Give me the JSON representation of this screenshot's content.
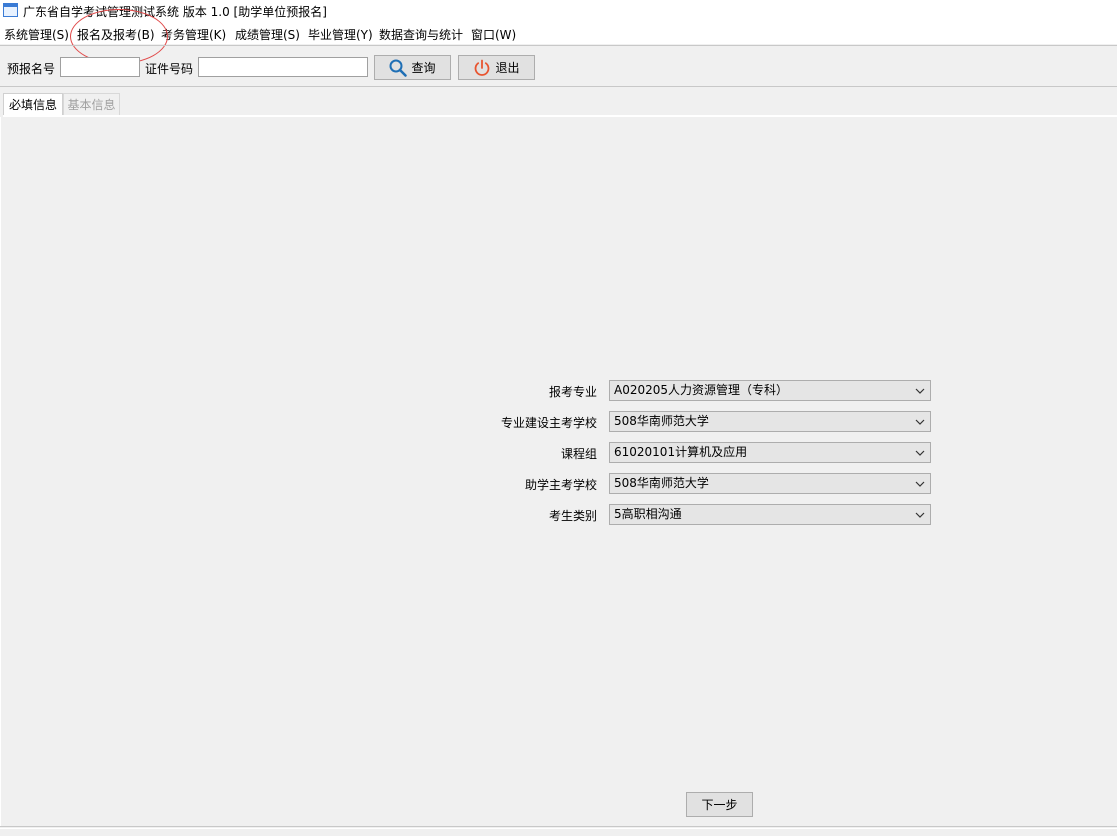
{
  "window": {
    "title": "广东省自学考试管理测试系统 版本 1.0 [助学单位预报名]"
  },
  "menu": {
    "items": [
      {
        "label": "系统管理(S)"
      },
      {
        "label": "报名及报考(B)"
      },
      {
        "label": "考务管理(K)"
      },
      {
        "label": "成绩管理(S)"
      },
      {
        "label": "毕业管理(Y)"
      },
      {
        "label": "数据查询与统计"
      },
      {
        "label": "窗口(W)"
      }
    ]
  },
  "toolbar": {
    "prereg_label": "预报名号",
    "prereg_value": "",
    "id_label": "证件号码",
    "id_value": "",
    "query_label": "查询",
    "exit_label": "退出"
  },
  "tabs": [
    {
      "label": "必填信息",
      "active": true
    },
    {
      "label": "基本信息",
      "active": false
    }
  ],
  "form": {
    "fields": [
      {
        "label": "报考专业",
        "value": "A020205人力资源管理（专科）"
      },
      {
        "label": "专业建设主考学校",
        "value": "508华南师范大学"
      },
      {
        "label": "课程组",
        "value": "61020101计算机及应用"
      },
      {
        "label": "助学主考学校",
        "value": "508华南师范大学"
      },
      {
        "label": "考生类别",
        "value": "5高职相沟通"
      }
    ],
    "next_label": "下一步"
  },
  "colors": {
    "window_bg": "#f0f0f0",
    "annotation": "#e14b4b",
    "query_icon": "#1f6fb5",
    "exit_icon": "#e8542f"
  },
  "icons": {
    "app": "app-window-icon",
    "query": "search-icon",
    "exit": "power-icon",
    "dropdown": "chevron-down-icon"
  }
}
